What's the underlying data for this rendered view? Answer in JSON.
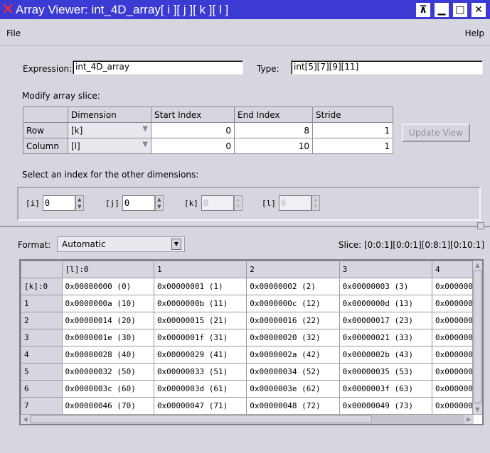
{
  "window": {
    "title": "Array Viewer: int_4D_array[ i ][ j ][ k ][ l ]",
    "buttons": [
      "⊼",
      "▁",
      "□",
      "✕"
    ]
  },
  "menu": {
    "file": "File",
    "help": "Help"
  },
  "expression": {
    "label": "Expression:",
    "value": "int_4D_array"
  },
  "type": {
    "label": "Type:",
    "value": "int[5][7][9][11]"
  },
  "slice_section": {
    "label": "Modify array slice:",
    "headers": [
      "Dimension",
      "Start Index",
      "End Index",
      "Stride"
    ],
    "rows": [
      {
        "name": "Row",
        "dimension": "[k]",
        "start": "0",
        "end": "8",
        "stride": "1"
      },
      {
        "name": "Column",
        "dimension": "[l]",
        "start": "0",
        "end": "10",
        "stride": "1"
      }
    ],
    "update_button": "Update View"
  },
  "other_dims": {
    "label": "Select an index for the other dimensions:",
    "spinners": [
      {
        "label": "[i]",
        "value": "0",
        "enabled": true
      },
      {
        "label": "[j]",
        "value": "0",
        "enabled": true
      },
      {
        "label": "[k]",
        "value": "0",
        "enabled": false
      },
      {
        "label": "[l]",
        "value": "0",
        "enabled": false
      }
    ]
  },
  "format": {
    "label": "Format:",
    "value": "Automatic"
  },
  "slice_info": "Slice: [0:0:1][0:0:1][0:8:1][0:10:1]",
  "grid": {
    "col_headers": [
      "[l]:0",
      "1",
      "2",
      "3",
      "4"
    ],
    "rows": [
      {
        "label": "[k]:0",
        "cells": [
          "0x00000000  (0)",
          "0x00000001  (1)",
          "0x00000002  (2)",
          "0x00000003  (3)",
          "0x0000000"
        ]
      },
      {
        "label": "1",
        "cells": [
          "0x0000000a  (10)",
          "0x0000000b  (11)",
          "0x0000000c  (12)",
          "0x0000000d  (13)",
          "0x0000000"
        ]
      },
      {
        "label": "2",
        "cells": [
          "0x00000014  (20)",
          "0x00000015  (21)",
          "0x00000016  (22)",
          "0x00000017  (23)",
          "0x0000000"
        ]
      },
      {
        "label": "3",
        "cells": [
          "0x0000001e  (30)",
          "0x0000001f  (31)",
          "0x00000020  (32)",
          "0x00000021  (33)",
          "0x0000000"
        ]
      },
      {
        "label": "4",
        "cells": [
          "0x00000028  (40)",
          "0x00000029  (41)",
          "0x0000002a  (42)",
          "0x0000002b  (43)",
          "0x0000000"
        ]
      },
      {
        "label": "5",
        "cells": [
          "0x00000032  (50)",
          "0x00000033  (51)",
          "0x00000034  (52)",
          "0x00000035  (53)",
          "0x0000000"
        ]
      },
      {
        "label": "6",
        "cells": [
          "0x0000003c  (60)",
          "0x0000003d  (61)",
          "0x0000003e  (62)",
          "0x0000003f  (63)",
          "0x0000000"
        ]
      },
      {
        "label": "7",
        "cells": [
          "0x00000046  (70)",
          "0x00000047  (71)",
          "0x00000048  (72)",
          "0x00000049  (73)",
          "0x0000000"
        ]
      }
    ]
  },
  "colors": {
    "titlebar": "#3b3bd3",
    "close_x": "#ff2a2a",
    "background": "#d6d6de"
  }
}
